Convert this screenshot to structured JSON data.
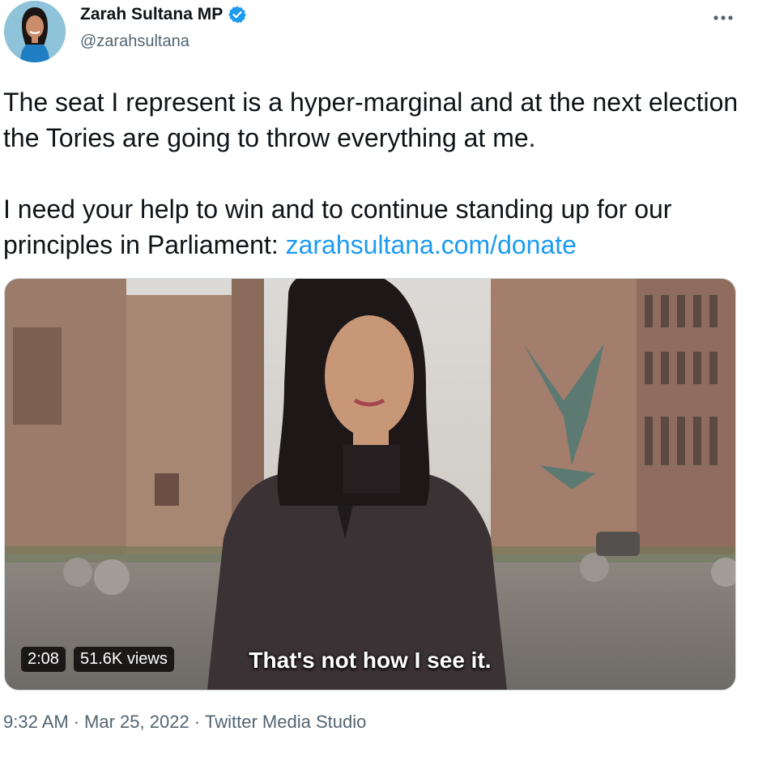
{
  "author": {
    "display_name": "Zarah Sultana MP",
    "handle": "@zarahsultana",
    "verified_icon": "verified-badge-icon",
    "verified_color": "#1d9bf0"
  },
  "tweet": {
    "paragraph1": "The seat I represent is a hyper-marginal and at the next election the Tories are going to throw everything at me.",
    "paragraph2": "I need your help to win and to continue standing up for our principles in Parliament:",
    "link_text": "zarahsultana.com/donate",
    "link_color": "#1d9bf0"
  },
  "media": {
    "duration": "2:08",
    "views": "51.6K views",
    "caption": "That's not how I see it."
  },
  "meta": {
    "time": "9:32 AM",
    "separator": "·",
    "date": "Mar 25, 2022",
    "source": "Twitter Media Studio"
  },
  "icons": {
    "more": "more-horizontal-icon"
  }
}
